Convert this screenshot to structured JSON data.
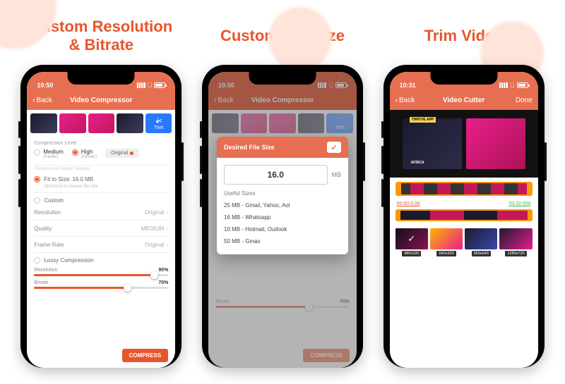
{
  "accent": "#e9552b",
  "panels": {
    "p1": {
      "title": "Custom Resolution\n& Bitrate"
    },
    "p2": {
      "title": "Custom File Size"
    },
    "p3": {
      "title": "Trim Video"
    }
  },
  "screen1": {
    "status_time": "10:50",
    "back": "Back",
    "nav_title": "Video Compressor",
    "trim_label": "Trim",
    "compression_level_label": "Compression Level",
    "opt_medium": "Medium",
    "opt_medium_sub": "(Faster)",
    "opt_high": "High",
    "opt_high_sub": "(Slower)",
    "opt_original": "Original",
    "speed_note": "Compression Speed: Slowest",
    "fit_label": "Fit to Size: 16.0 MB",
    "fit_sub": "Optimized to chosen file size",
    "custom_label": "Custom",
    "rows": {
      "resolution": "Resolution",
      "resolution_val": "Original",
      "quality": "Quality",
      "quality_val": "MEDIUM",
      "framerate": "Frame Rate",
      "framerate_val": "Original"
    },
    "lossy_label": "Lossy Compression",
    "slider_res_label": "Resolution",
    "slider_res_val": "90%",
    "slider_bitrate_label": "Bitrate",
    "slider_bitrate_val": "70%",
    "compress_btn": "COMPRESS"
  },
  "screen2": {
    "status_time": "10:50",
    "back": "Back",
    "nav_title": "Video Compressor",
    "modal_title": "Desired File Size",
    "size_value": "16.0",
    "size_unit": "MB",
    "useful_title": "Useful Sizes",
    "useful_items": [
      "25 MB - Gmail, Yahoo, Aol",
      "16 MB - Whatsapp",
      "10 MB - Hotmail, Outlook",
      "50 MB - Gmax"
    ],
    "slider_bitrate_label": "Bitrate",
    "slider_bitrate_val": "70%"
  },
  "screen3": {
    "status_time": "10:31",
    "back": "Back",
    "nav_title": "Video Cutter",
    "done": "Done",
    "yellow_tag": "THRYVE APP",
    "africa": "AFRICA",
    "time_start": "00:00:0.00",
    "time_end": "03:32:550",
    "clip_dims": [
      "480x320",
      "640x320",
      "960x640",
      "1280x720"
    ]
  }
}
